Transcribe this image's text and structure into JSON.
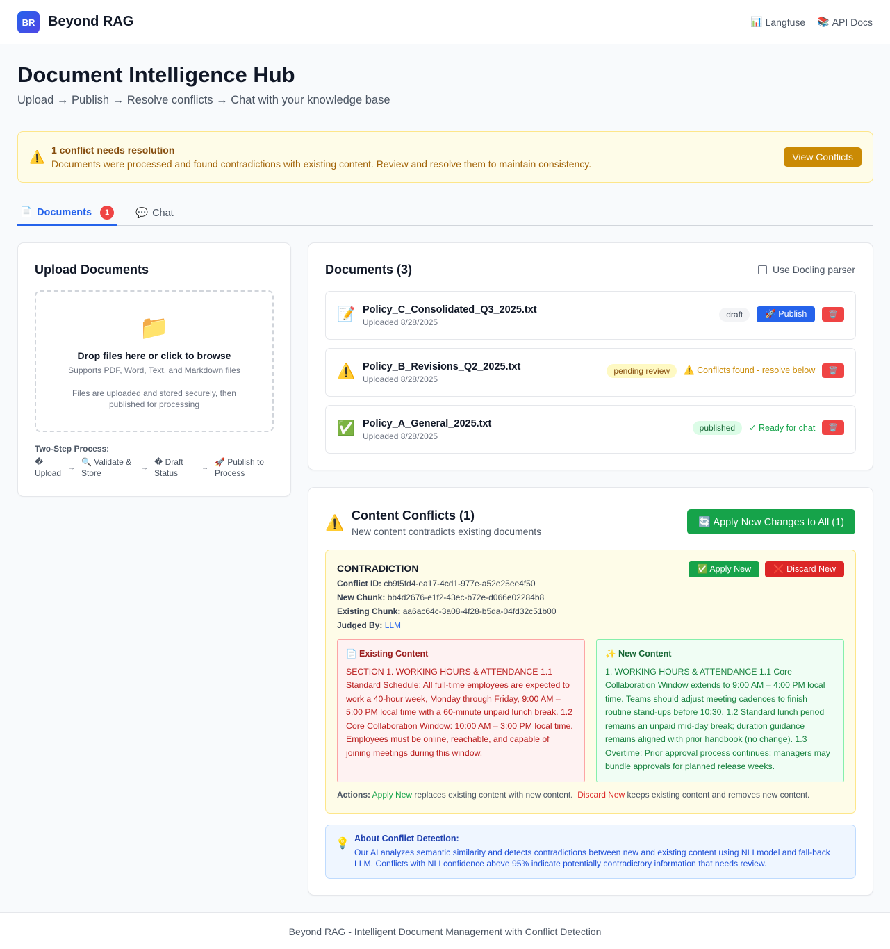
{
  "header": {
    "logo": "BR",
    "brand": "Beyond RAG",
    "links": [
      {
        "icon": "bar-chart-icon",
        "glyph": "📊",
        "label": "Langfuse"
      },
      {
        "icon": "books-icon",
        "glyph": "📚",
        "label": "API Docs"
      }
    ]
  },
  "page": {
    "title": "Document Intelligence Hub",
    "subtitle": "Upload → Publish → Resolve conflicts → Chat with your knowledge base"
  },
  "banner": {
    "title": "1 conflict needs resolution",
    "description": "Documents were processed and found contradictions with existing content. Review and resolve them to maintain consistency.",
    "button": "View Conflicts"
  },
  "tabs": [
    {
      "icon": "📄",
      "label": "Documents",
      "badge": "1",
      "active": true
    },
    {
      "icon": "💬",
      "label": "Chat",
      "active": false
    }
  ],
  "upload": {
    "title": "Upload Documents",
    "drop_title": "Drop files here or click to browse",
    "supports": "Supports PDF, Word, Text, and Markdown files",
    "note": "Files are uploaded and stored securely, then published for processing",
    "process_title": "Two-Step Process:",
    "steps": [
      {
        "line1": "�",
        "line2": "Upload"
      },
      {
        "line1": "🔍 Validate &",
        "line2": "Store"
      },
      {
        "line1": "� Draft",
        "line2": "Status"
      },
      {
        "line1": "🚀 Publish to",
        "line2": "Process"
      }
    ],
    "arrow": "→"
  },
  "documents": {
    "title": "Documents (3)",
    "docling_label": "Use Docling parser",
    "items": [
      {
        "icon": "📝",
        "name": "Policy_C_Consolidated_Q3_2025.txt",
        "date": "Uploaded 8/28/2025",
        "status": "draft",
        "action": "🚀 Publish",
        "delete": "🗑️"
      },
      {
        "icon": "⚠️",
        "name": "Policy_B_Revisions_Q2_2025.txt",
        "date": "Uploaded 8/28/2025",
        "status": "pending review",
        "note": "⚠️ Conflicts found - resolve below",
        "delete": "🗑️"
      },
      {
        "icon": "✅",
        "name": "Policy_A_General_2025.txt",
        "date": "Uploaded 8/28/2025",
        "status": "published",
        "note": "✓ Ready for chat",
        "delete": "🗑️"
      }
    ]
  },
  "conflicts": {
    "title": "Content Conflicts (1)",
    "subtitle": "New content contradicts existing documents",
    "apply_all": "🔄 Apply New Changes to All (1)",
    "item": {
      "kind": "CONTRADICTION",
      "conflict_id_label": "Conflict ID:",
      "conflict_id": "cb9f5fd4-ea17-4cd1-977e-a52e25ee4f50",
      "new_chunk_label": "New Chunk:",
      "new_chunk": "bb4d2676-e1f2-43ec-b72e-d066e02284b8",
      "existing_chunk_label": "Existing Chunk:",
      "existing_chunk": "aa6ac64c-3a08-4f28-b5da-04fd32c51b00",
      "judged_label": "Judged By:",
      "judged_by": "LLM",
      "apply": "✅ Apply New",
      "discard": "❌ Discard New",
      "existing_title": "📄 Existing Content",
      "existing_text": "SECTION 1. WORKING HOURS & ATTENDANCE 1.1 Standard Schedule: All full-time employees are expected to work a 40-hour week, Monday through Friday, 9:00 AM – 5:00 PM local time with a 60-minute unpaid lunch break. 1.2 Core Collaboration Window: 10:00 AM – 3:00 PM local time. Employees must be online, reachable, and capable of joining meetings during this window.",
      "new_title": "✨ New Content",
      "new_text": "1. WORKING HOURS & ATTENDANCE 1.1 Core Collaboration Window extends to 9:00 AM – 4:00 PM local time. Teams should adjust meeting cadences to finish routine stand-ups before 10:30. 1.2 Standard lunch period remains an unpaid mid-day break; duration guidance remains aligned with prior handbook (no change). 1.3 Overtime: Prior approval process continues; managers may bundle approvals for planned release weeks.",
      "actions_label": "Actions:",
      "apply_word": "Apply New",
      "apply_desc": "replaces existing content with new content.",
      "discard_word": "Discard New",
      "discard_desc": "keeps existing content and removes new content."
    },
    "about": {
      "title": "About Conflict Detection:",
      "text": "Our AI analyzes semantic similarity and detects contradictions between new and existing content using NLI model and fall-back LLM. Conflicts with NLI confidence above 95% indicate potentially contradictory information that needs review."
    }
  },
  "footer": "Beyond RAG - Intelligent Document Management with Conflict Detection"
}
